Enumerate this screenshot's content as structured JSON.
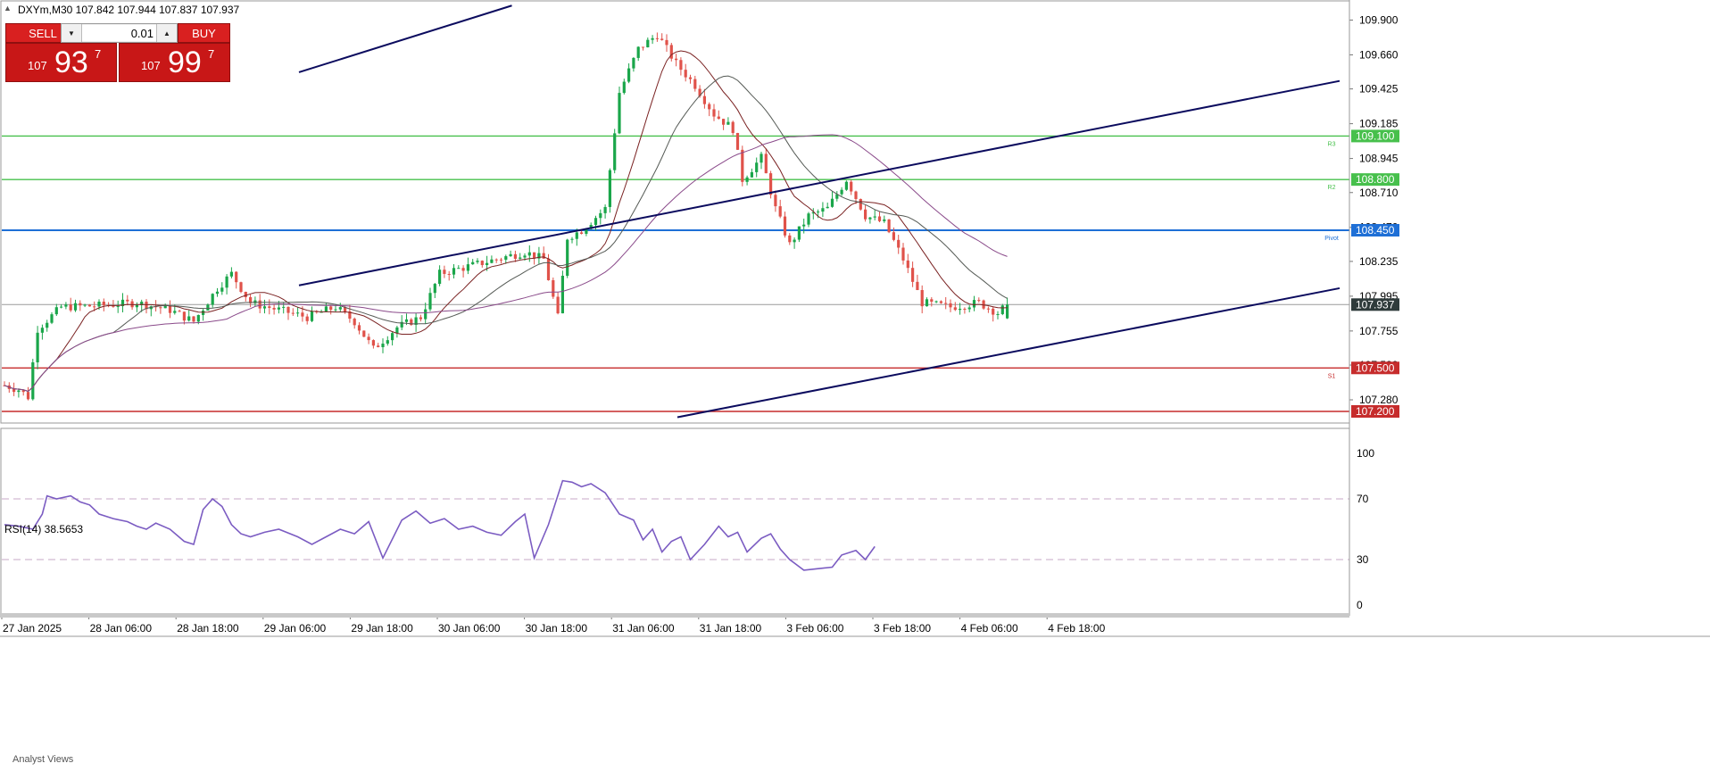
{
  "header": {
    "symbol_info": "DXYm,M30  107.842 107.944 107.837 107.937"
  },
  "trade_panel": {
    "sell_label": "SELL",
    "buy_label": "BUY",
    "lot_value": "0.01",
    "sell_price": {
      "prefix": "107",
      "big": "93",
      "sup": "7"
    },
    "buy_price": {
      "prefix": "107",
      "big": "99",
      "sup": "7"
    }
  },
  "colors": {
    "bull": "#1aa64a",
    "bear": "#e0524a",
    "green_level": "#47c04c",
    "pivot_level": "#1e6fd6",
    "red_level": "#c62c2c",
    "trendline": "#0b0b5e",
    "rsi": "#7b5cc2",
    "current_price": "#2f3b3b"
  },
  "chart_data": [
    {
      "type": "candlestick",
      "symbol": "DXYm",
      "timeframe": "M30",
      "ohlc_last": {
        "open": 107.842,
        "high": 107.944,
        "low": 107.837,
        "close": 107.937
      },
      "ylim": [
        107.12,
        110.02
      ],
      "y_ticks": [
        "109.900",
        "109.660",
        "109.425",
        "109.185",
        "108.945",
        "108.710",
        "108.470",
        "108.235",
        "107.995",
        "107.755",
        "107.520",
        "107.280"
      ],
      "current_price": {
        "value": 107.937,
        "label": "107.937"
      },
      "levels": [
        {
          "name": "R3",
          "value": 109.1,
          "label": "109.100",
          "color": "green"
        },
        {
          "name": "R2",
          "value": 108.8,
          "label": "108.800",
          "color": "green"
        },
        {
          "name": "Pivot",
          "value": 108.45,
          "label": "108.450",
          "color": "blue"
        },
        {
          "name": "S1",
          "value": 107.5,
          "label": "107.500",
          "color": "red"
        },
        {
          "value": 107.2,
          "label": "107.200",
          "color": "red"
        }
      ],
      "x_labels": [
        "27 Jan 2025",
        "28 Jan 06:00",
        "28 Jan 18:00",
        "29 Jan 06:00",
        "29 Jan 18:00",
        "30 Jan 06:00",
        "30 Jan 18:00",
        "31 Jan 06:00",
        "31 Jan 18:00",
        "3 Feb 06:00",
        "3 Feb 18:00",
        "4 Feb 06:00",
        "4 Feb 18:00"
      ],
      "trendlines": [
        {
          "from": {
            "bar": 0,
            "value": 109.54
          },
          "to": {
            "bar": 45,
            "value": 110.0
          }
        },
        {
          "from": {
            "bar": 0,
            "value": 108.07
          },
          "to": {
            "bar": 220,
            "value": 109.48
          }
        },
        {
          "from": {
            "bar": 80,
            "value": 107.16
          },
          "to": {
            "bar": 220,
            "value": 108.05
          }
        }
      ],
      "bars": 130,
      "close_path": [
        [
          0,
          107.38
        ],
        [
          3,
          107.35
        ],
        [
          5,
          107.3
        ],
        [
          7,
          107.77
        ],
        [
          12,
          107.92
        ],
        [
          20,
          107.93
        ],
        [
          28,
          107.95
        ],
        [
          35,
          107.9
        ],
        [
          40,
          107.82
        ],
        [
          45,
          108.05
        ],
        [
          48,
          108.15
        ],
        [
          52,
          107.95
        ],
        [
          58,
          107.9
        ],
        [
          64,
          107.85
        ],
        [
          70,
          107.92
        ],
        [
          74,
          107.82
        ],
        [
          78,
          107.63
        ],
        [
          83,
          107.78
        ],
        [
          88,
          107.85
        ],
        [
          92,
          108.15
        ],
        [
          98,
          108.2
        ],
        [
          104,
          108.25
        ],
        [
          110,
          108.3
        ],
        [
          114,
          108.25
        ],
        [
          117,
          107.85
        ],
        [
          119,
          108.4
        ],
        [
          122,
          108.45
        ],
        [
          127,
          108.6
        ],
        [
          130,
          109.4
        ],
        [
          134,
          109.7
        ],
        [
          138,
          109.8
        ],
        [
          142,
          109.6
        ],
        [
          146,
          109.45
        ],
        [
          150,
          109.25
        ],
        [
          154,
          109.15
        ],
        [
          156,
          108.8
        ],
        [
          160,
          108.95
        ],
        [
          163,
          108.6
        ],
        [
          166,
          108.35
        ],
        [
          170,
          108.55
        ],
        [
          174,
          108.6
        ],
        [
          178,
          108.8
        ],
        [
          182,
          108.55
        ],
        [
          186,
          108.5
        ],
        [
          190,
          108.25
        ],
        [
          194,
          107.95
        ],
        [
          200,
          107.92
        ],
        [
          206,
          107.95
        ],
        [
          210,
          107.88
        ],
        [
          212,
          107.937
        ]
      ]
    },
    {
      "type": "line",
      "title": "RSI(14) 38.5653",
      "ylim": [
        0,
        100
      ],
      "y_ticks": [
        "100",
        "70",
        "30",
        "0"
      ],
      "levels": [
        70,
        30
      ],
      "series": [
        {
          "values": [
            [
              0,
              53
            ],
            [
              3,
              52
            ],
            [
              6,
              50
            ],
            [
              8,
              60
            ],
            [
              9,
              72
            ],
            [
              11,
              70
            ],
            [
              14,
              72
            ],
            [
              16,
              68
            ],
            [
              18,
              66
            ],
            [
              20,
              60
            ],
            [
              23,
              57
            ],
            [
              26,
              55
            ],
            [
              28,
              52
            ],
            [
              30,
              50
            ],
            [
              32,
              54
            ],
            [
              35,
              50
            ],
            [
              38,
              42
            ],
            [
              40,
              40
            ],
            [
              42,
              63
            ],
            [
              44,
              70
            ],
            [
              46,
              65
            ],
            [
              48,
              53
            ],
            [
              50,
              47
            ],
            [
              52,
              45
            ],
            [
              55,
              48
            ],
            [
              58,
              50
            ],
            [
              62,
              45
            ],
            [
              65,
              40
            ],
            [
              68,
              45
            ],
            [
              71,
              50
            ],
            [
              74,
              47
            ],
            [
              77,
              55
            ],
            [
              80,
              31
            ],
            [
              84,
              56
            ],
            [
              87,
              62
            ],
            [
              90,
              54
            ],
            [
              93,
              57
            ],
            [
              96,
              50
            ],
            [
              99,
              52
            ],
            [
              102,
              48
            ],
            [
              105,
              46
            ],
            [
              108,
              55
            ],
            [
              110,
              60
            ],
            [
              112,
              31
            ],
            [
              115,
              53
            ],
            [
              118,
              82
            ],
            [
              120,
              81
            ],
            [
              122,
              78
            ],
            [
              124,
              80
            ],
            [
              127,
              74
            ],
            [
              130,
              60
            ],
            [
              133,
              56
            ],
            [
              135,
              43
            ],
            [
              137,
              50
            ],
            [
              139,
              35
            ],
            [
              141,
              42
            ],
            [
              143,
              45
            ],
            [
              145,
              30
            ],
            [
              148,
              40
            ],
            [
              151,
              52
            ],
            [
              153,
              45
            ],
            [
              155,
              48
            ],
            [
              157,
              35
            ],
            [
              160,
              44
            ],
            [
              162,
              47
            ],
            [
              164,
              37
            ],
            [
              166,
              30
            ],
            [
              169,
              23
            ],
            [
              172,
              24
            ],
            [
              175,
              25
            ],
            [
              177,
              33
            ],
            [
              180,
              36
            ],
            [
              182,
              30
            ],
            [
              184,
              38.5653
            ]
          ]
        }
      ]
    }
  ],
  "bottom_panel": {
    "tab_label": "Analyst Views"
  }
}
